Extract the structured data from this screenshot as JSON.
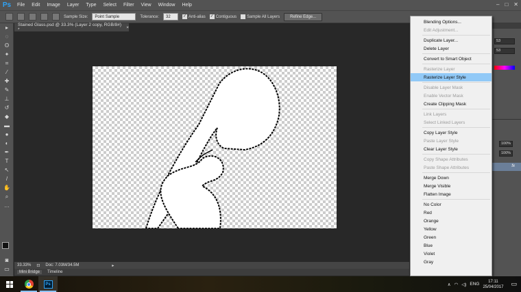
{
  "menubar": {
    "logo": "Ps",
    "items": [
      "File",
      "Edit",
      "Image",
      "Layer",
      "Type",
      "Select",
      "Filter",
      "View",
      "Window",
      "Help"
    ],
    "minimize": "–",
    "maximize": "□",
    "close": "✕"
  },
  "options": {
    "sample_size_label": "Sample Size:",
    "sample_size_value": "Point Sample",
    "tolerance_label": "Tolerance:",
    "tolerance_value": "32",
    "anti_alias": "Anti-alias",
    "contiguous": "Contiguous",
    "sample_all_layers": "Sample All Layers",
    "refine_edge": "Refine Edge..."
  },
  "document": {
    "tab_title": "Stained Glass.psd @ 33.3% (Layer 2 copy, RGB/8#) *",
    "tab_close": "×",
    "zoom": "33.33%",
    "doc_info": "Doc: 7.03M/34.5M"
  },
  "bottom_tabs": [
    "Mini Bridge",
    "Timeline"
  ],
  "right_panel": {
    "values": [
      "53",
      "53",
      "100%",
      "100%"
    ],
    "fx": "fx"
  },
  "context_menu": {
    "items": [
      {
        "label": "Blending Options...",
        "state": "enabled"
      },
      {
        "label": "Edit Adjustment...",
        "state": "disabled"
      },
      {
        "sep": true
      },
      {
        "label": "Duplicate Layer...",
        "state": "enabled"
      },
      {
        "label": "Delete Layer",
        "state": "enabled"
      },
      {
        "sep": true
      },
      {
        "label": "Convert to Smart Object",
        "state": "enabled"
      },
      {
        "sep": true
      },
      {
        "label": "Rasterize Layer",
        "state": "disabled"
      },
      {
        "label": "Rasterize Layer Style",
        "state": "highlighted"
      },
      {
        "sep": true
      },
      {
        "label": "Disable Layer Mask",
        "state": "disabled"
      },
      {
        "label": "Enable Vector Mask",
        "state": "disabled"
      },
      {
        "label": "Create Clipping Mask",
        "state": "enabled"
      },
      {
        "sep": true
      },
      {
        "label": "Link Layers",
        "state": "disabled"
      },
      {
        "label": "Select Linked Layers",
        "state": "disabled"
      },
      {
        "sep": true
      },
      {
        "label": "Copy Layer Style",
        "state": "enabled"
      },
      {
        "label": "Paste Layer Style",
        "state": "disabled"
      },
      {
        "label": "Clear Layer Style",
        "state": "enabled"
      },
      {
        "sep": true
      },
      {
        "label": "Copy Shape Attributes",
        "state": "disabled"
      },
      {
        "label": "Paste Shape Attributes",
        "state": "disabled"
      },
      {
        "sep": true
      },
      {
        "label": "Merge Down",
        "state": "enabled"
      },
      {
        "label": "Merge Visible",
        "state": "enabled"
      },
      {
        "label": "Flatten Image",
        "state": "enabled"
      },
      {
        "sep": true
      },
      {
        "label": "No Color",
        "state": "enabled"
      },
      {
        "label": "Red",
        "state": "enabled"
      },
      {
        "label": "Orange",
        "state": "enabled"
      },
      {
        "label": "Yellow",
        "state": "enabled"
      },
      {
        "label": "Green",
        "state": "enabled"
      },
      {
        "label": "Blue",
        "state": "enabled"
      },
      {
        "label": "Violet",
        "state": "enabled"
      },
      {
        "label": "Gray",
        "state": "enabled"
      }
    ]
  },
  "taskbar": {
    "ps_label": "Ps",
    "language": "ENG",
    "time": "17:11",
    "date": "25/04/2017"
  },
  "colors": {
    "highlight": "#91c9f7",
    "ps_blue": "#2fa3f6"
  }
}
